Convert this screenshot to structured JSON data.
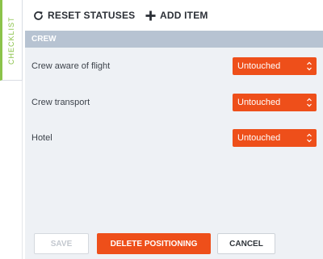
{
  "side_tab": {
    "label": "CHECKLIST",
    "accent": "#8bc34a"
  },
  "toolbar": {
    "reset_label": "RESET STATUSES",
    "add_label": "ADD ITEM"
  },
  "section": {
    "title": "CREW"
  },
  "items": [
    {
      "label": "Crew aware of flight",
      "status": "Untouched"
    },
    {
      "label": "Crew transport",
      "status": "Untouched"
    },
    {
      "label": "Hotel",
      "status": "Untouched"
    }
  ],
  "footer": {
    "save_label": "SAVE",
    "delete_label": "DELETE POSITIONING",
    "cancel_label": "CANCEL"
  },
  "colors": {
    "status_bg": "#ee4f1a",
    "section_bg": "#b7c3d2",
    "panel_bg": "#eef1f5"
  }
}
